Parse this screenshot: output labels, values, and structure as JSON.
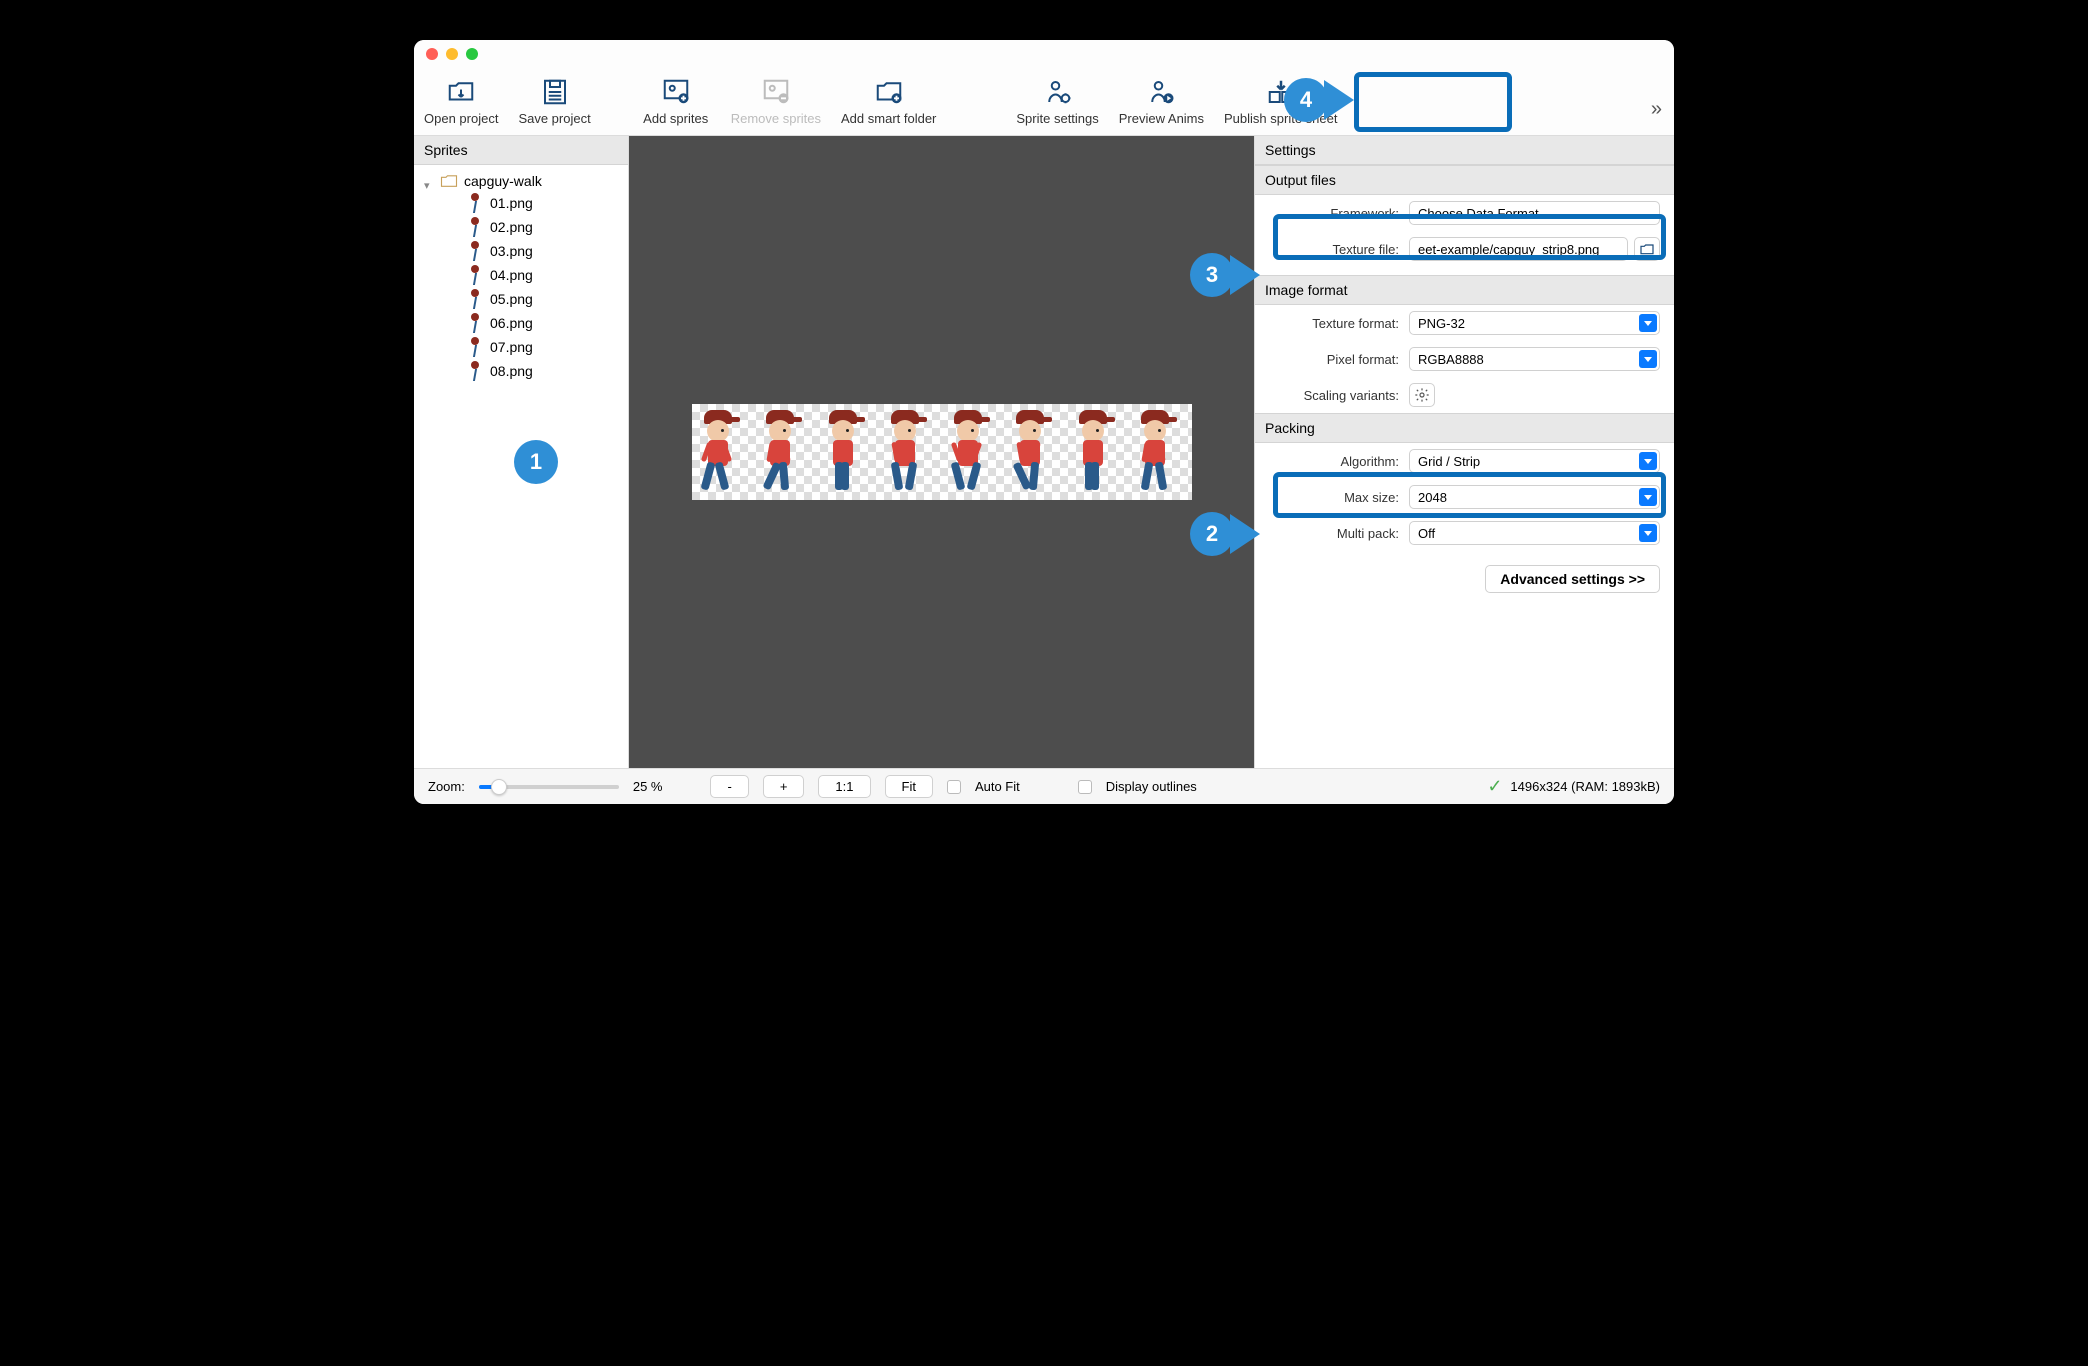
{
  "toolbar": {
    "open": "Open project",
    "save": "Save project",
    "add_sprites": "Add sprites",
    "remove_sprites": "Remove sprites",
    "add_folder": "Add smart folder",
    "sprite_settings": "Sprite settings",
    "preview_anims": "Preview Anims",
    "publish": "Publish sprite sheet"
  },
  "sidebar": {
    "title": "Sprites",
    "folder": "capguy-walk",
    "files": [
      "01.png",
      "02.png",
      "03.png",
      "04.png",
      "05.png",
      "06.png",
      "07.png",
      "08.png"
    ]
  },
  "settings": {
    "title": "Settings",
    "output_section": "Output files",
    "framework_label": "Framework:",
    "framework_value": "Choose Data Format",
    "texture_file_label": "Texture file:",
    "texture_file_value": "eet-example/capguy_strip8.png",
    "image_section": "Image format",
    "texture_format_label": "Texture format:",
    "texture_format_value": "PNG-32",
    "pixel_format_label": "Pixel format:",
    "pixel_format_value": "RGBA8888",
    "scaling_label": "Scaling variants:",
    "packing_section": "Packing",
    "algorithm_label": "Algorithm:",
    "algorithm_value": "Grid / Strip",
    "maxsize_label": "Max size:",
    "maxsize_value": "2048",
    "multipack_label": "Multi pack:",
    "multipack_value": "Off",
    "advanced": "Advanced settings >>"
  },
  "statusbar": {
    "zoom_label": "Zoom:",
    "zoom_pct": "25 %",
    "minus": "-",
    "plus": "+",
    "one": "1:1",
    "fit": "Fit",
    "autofit": "Auto Fit",
    "outlines": "Display outlines",
    "dims": "1496x324 (RAM: 1893kB)"
  },
  "callouts": {
    "c1": "1",
    "c2": "2",
    "c3": "3",
    "c4": "4"
  }
}
